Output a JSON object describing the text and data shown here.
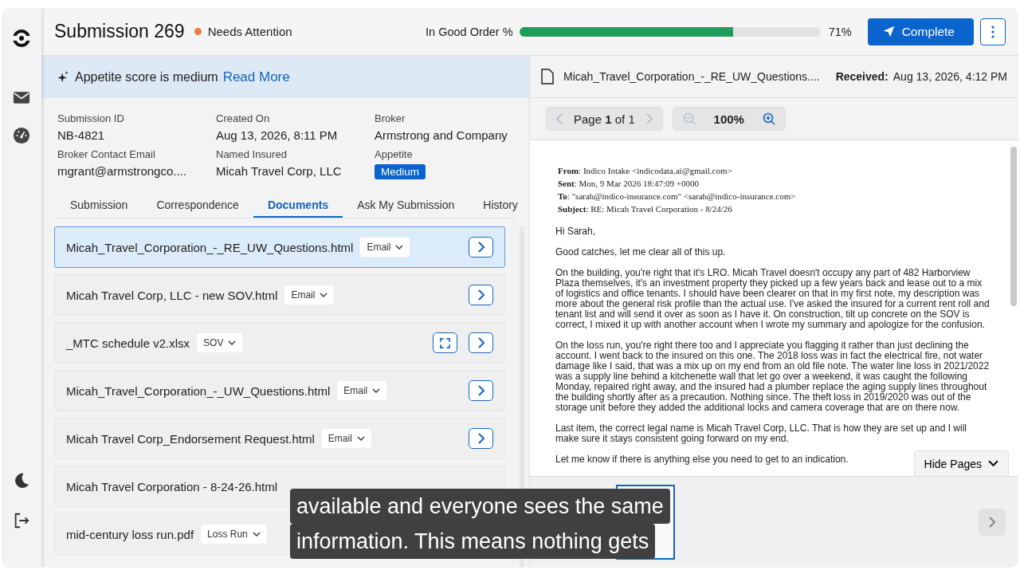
{
  "header": {
    "title": "Submission 269",
    "status": "Needs Attention",
    "progress_label": "In Good Order %",
    "progress": {
      "level": 0.71
    },
    "progress_reading": "71%",
    "complete_button": "Complete"
  },
  "banner": {
    "text": "Appetite score is medium",
    "link": "Read More"
  },
  "fields": [
    {
      "label": "Submission ID",
      "value": "NB-4821",
      "kind": "text"
    },
    {
      "label": "Created On",
      "value": "Aug 13, 2026, 8:11 PM",
      "kind": "text"
    },
    {
      "label": "Broker",
      "value": "Armstrong and Company",
      "kind": "text"
    },
    {
      "label": "Broker Contact Email",
      "value": "mgrant@armstrongco....",
      "kind": "text"
    },
    {
      "label": "Named Insured",
      "value": "Micah Travel Corp, LLC",
      "kind": "text"
    },
    {
      "label": "Appetite",
      "value": "Medium",
      "kind": "badge"
    }
  ],
  "tabs": [
    {
      "label": "Submission",
      "selected": false
    },
    {
      "label": "Correspondence",
      "selected": false
    },
    {
      "label": "Documents",
      "selected": true
    },
    {
      "label": "Ask My Submission",
      "selected": false
    },
    {
      "label": "History",
      "selected": false
    }
  ],
  "documents": [
    {
      "name": "Micah_Travel_Corporation_-_RE_UW_Questions.html",
      "tag": "Email",
      "selected": true,
      "expand_button": false,
      "open_button": true
    },
    {
      "name": "Micah Travel Corp, LLC - new SOV.html",
      "tag": "Email",
      "selected": false,
      "expand_button": false,
      "open_button": true
    },
    {
      "name": "_MTC schedule v2.xlsx",
      "tag": "SOV",
      "selected": false,
      "expand_button": true,
      "open_button": true
    },
    {
      "name": "Micah_Travel_Corporation_-_UW_Questions.html",
      "tag": "Email",
      "selected": false,
      "expand_button": false,
      "open_button": true
    },
    {
      "name": "Micah Travel Corp_Endorsement Request.html",
      "tag": "Email",
      "selected": false,
      "expand_button": false,
      "open_button": true
    },
    {
      "name": "Micah Travel Corporation - 8-24-26.html",
      "selected": false,
      "expand_button": false,
      "open_button": false
    },
    {
      "name": "mid-century loss run.pdf",
      "tag": "Loss Run",
      "selected": false,
      "expand_button": false,
      "open_button": false
    }
  ],
  "viewer": {
    "file_name": "Micah_Travel_Corporation_-_RE_UW_Questions....",
    "received_label": "Received:",
    "received_value": "Aug 13, 2026, 4:12 PM",
    "page_indicator": "Page **1** of 1",
    "zoom": "100%",
    "hide_pages_button": "Hide Pages",
    "email_headers": [
      "**From**: Indico Intake <indicodata.ai@gmail.com>",
      "**Sent**: Mon, 9 Mar 2026 18:47:09 +0000",
      "**To**: \"sarah@indico-insurance.com\" <sarah@indico-insurance.com>",
      "**Subject**: RE: Micah Travel Corporation - 8/24/26"
    ],
    "email_paragraphs": [
      "Hi Sarah,",
      "Good catches, let me clear all of this up.",
      "On the building, you're right that it's LRO. Micah Travel doesn't occupy any part of 482 Harborview Plaza themselves, it's an investment property they picked up a few years back and lease out to a mix of logistics and office tenants. I should have been clearer on that in my first note, my description was more about the general risk profile than the actual use. I've asked the insured for a current rent roll and tenant list and will send it over as soon as I have it. On construction, tilt up concrete on the SOV is correct, I mixed it up with another account when I wrote my summary and apologize for the confusion.",
      "On the loss run, you're right there too and I appreciate you flagging it rather than just declining the account. I went back to the insured on this one. The 2018 loss was in fact the electrical fire, not water damage like I said, that was a mix up on my end from an old file note. The water line loss in 2021/2022 was a supply line behind a kitchenette wall that let go over a weekend, it was caught the following Monday, repaired right away, and the insured had a plumber replace the aging supply lines throughout the building shortly after as a precaution. Nothing since. The theft loss in 2019/2020 was out of the storage unit before they added the additional locks and camera coverage that are on there now.",
      "Last item, the correct legal name is Micah Travel Corp, LLC. That is how they are set up and I will make sure it stays consistent going forward on my end.",
      "Let me know if there is anything else you need to get to an indication."
    ],
    "thumbnails": [
      {
        "selected": true
      }
    ]
  },
  "caption": {
    "lines": [
      "available and everyone sees the same",
      "information. This means nothing gets"
    ]
  }
}
